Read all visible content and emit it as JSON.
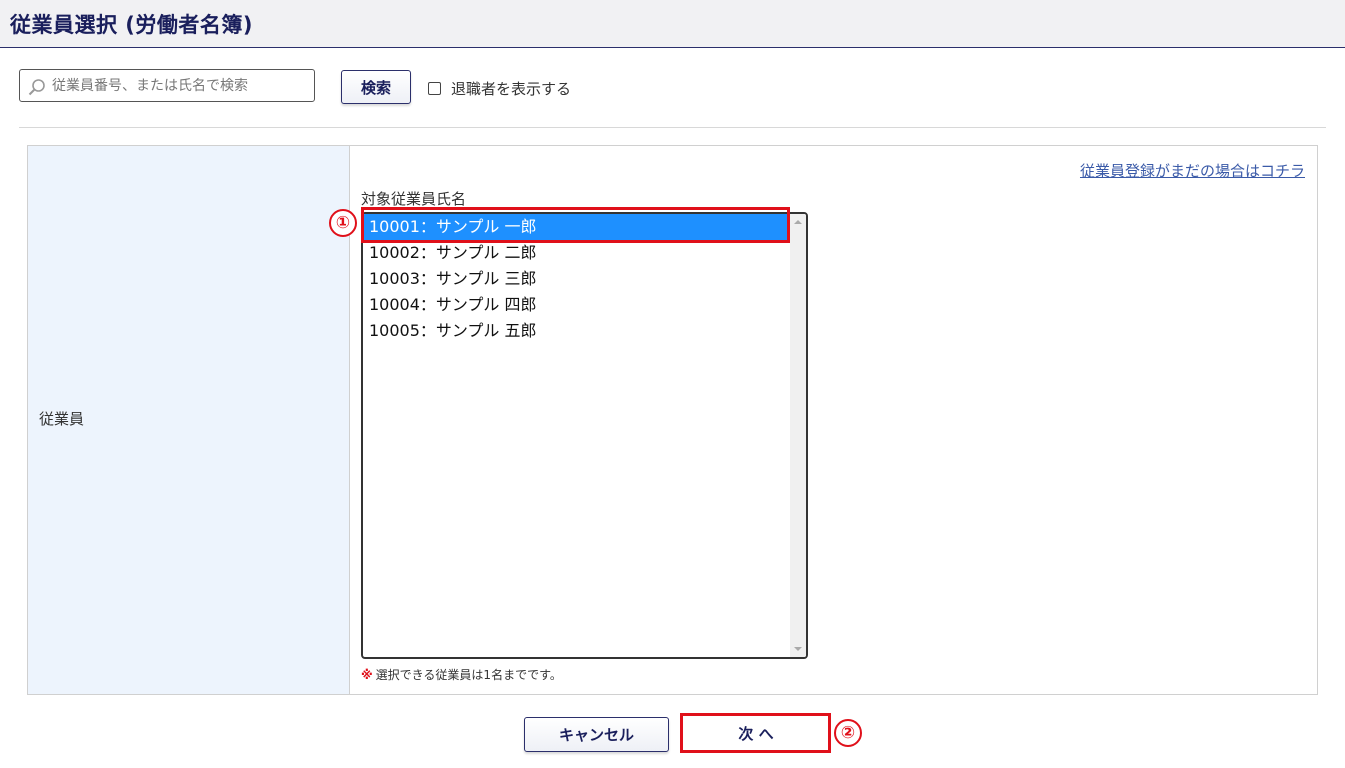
{
  "header": {
    "title": "従業員選択 (労働者名簿)"
  },
  "search": {
    "placeholder": "従業員番号、または氏名で検索",
    "button_label": "検索",
    "show_retired_label": "退職者を表示する"
  },
  "form": {
    "field_label": "従業員",
    "register_link": "従業員登録がまだの場合はコチラ",
    "list_label": "対象従業員氏名",
    "employees": [
      {
        "label": "10001：サンプル 一郎",
        "selected": true
      },
      {
        "label": "10002：サンプル 二郎",
        "selected": false
      },
      {
        "label": "10003：サンプル 三郎",
        "selected": false
      },
      {
        "label": "10004：サンプル 四郎",
        "selected": false
      },
      {
        "label": "10005：サンプル 五郎",
        "selected": false
      }
    ],
    "note_mark": "※",
    "note_text": "選択できる従業員は1名までです。"
  },
  "footer": {
    "cancel_label": "キャンセル",
    "next_label": "次 へ"
  },
  "annotations": {
    "step1": "①",
    "step2": "②"
  },
  "colors": {
    "accent": "#1a1f5c",
    "selection": "#1e90ff",
    "highlight": "#e0101a",
    "label_bg": "#edf4fd"
  }
}
